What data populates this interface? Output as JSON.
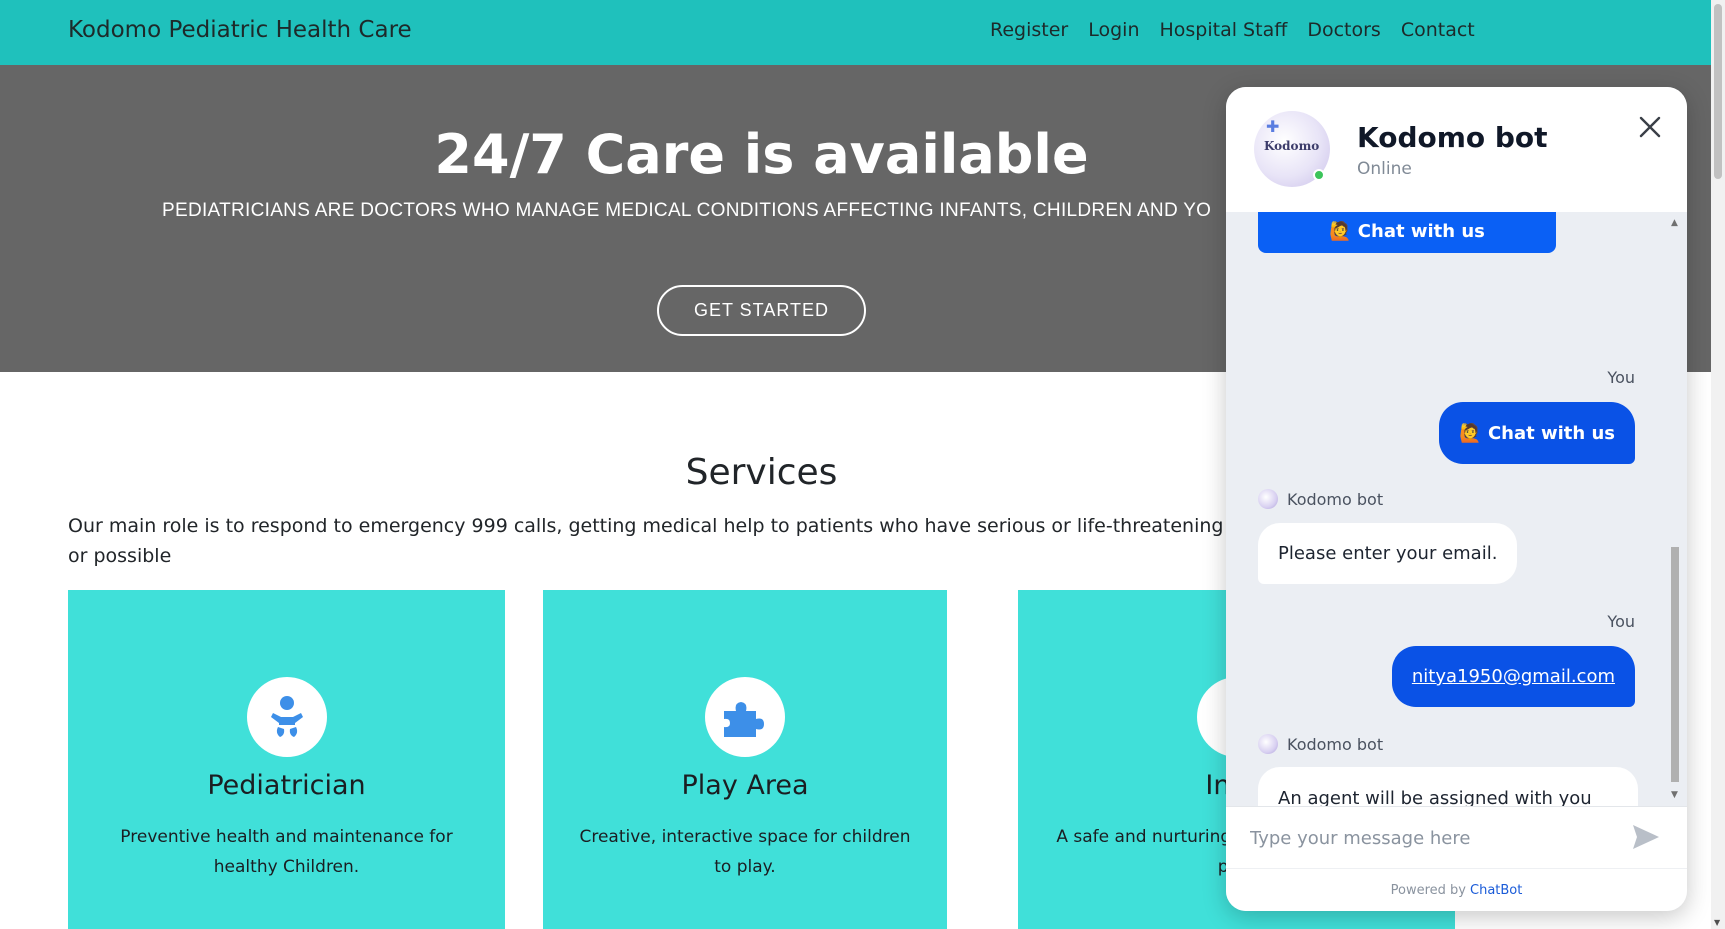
{
  "navbar": {
    "brand": "Kodomo Pediatric Health Care",
    "links": [
      "Register",
      "Login",
      "Hospital Staff",
      "Doctors",
      "Contact"
    ]
  },
  "hero": {
    "title": "24/7 Care is available",
    "subtitle": "PEDIATRICIANS ARE DOCTORS WHO MANAGE MEDICAL CONDITIONS AFFECTING INFANTS, CHILDREN AND YO",
    "button": "GET STARTED"
  },
  "services": {
    "title": "Services",
    "description": "Our main role is to respond to emergency 999 calls, getting medical help to patients who have serious or life-threatening injuries or possible",
    "cards": [
      {
        "icon": "baby-icon",
        "title": "Pediatrician",
        "text": "Preventive health and maintenance for healthy Children."
      },
      {
        "icon": "puzzle-icon",
        "title": "Play Area",
        "text": "Creative, interactive space for children to play."
      },
      {
        "icon": "infant-icon",
        "title": "Infar",
        "text": "A safe and nurturing p socialize, learn and prac"
      }
    ]
  },
  "chat": {
    "bot_name": "Kodomo bot",
    "status": "Online",
    "avatar_text": "Kodomo",
    "messages": {
      "top_button": "🙋 Chat with us",
      "you_label_1": "You",
      "user_1": "🙋 Chat with us",
      "bot_label_1": "Kodomo bot",
      "bot_1": "Please enter your email.",
      "you_label_2": "You",
      "user_2": "nitya1950@gmail.com",
      "bot_label_2": "Kodomo bot",
      "bot_2": "An agent will be assigned with you shortly..."
    },
    "input_placeholder": "Type your message here",
    "footer_prefix": "Powered by",
    "footer_link": "ChatBot"
  },
  "colors": {
    "navbar": "#1fc1bc",
    "hero": "#666666",
    "card": "#40e0d9",
    "chat_button": "#0a52e6",
    "icon_blue": "#3d8fe8"
  }
}
